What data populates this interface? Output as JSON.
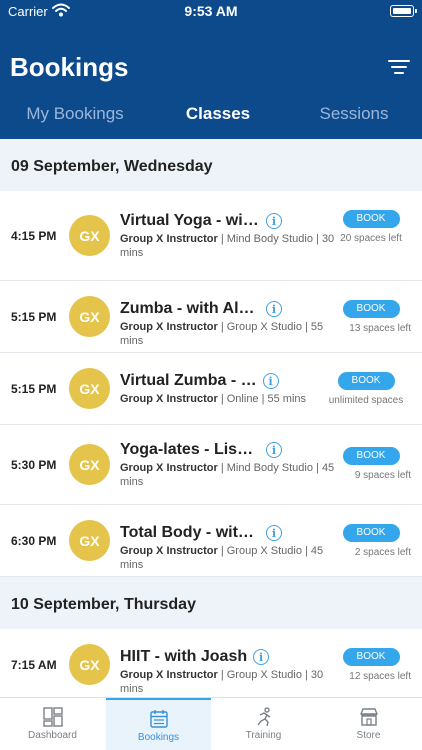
{
  "status_bar": {
    "carrier": "Carrier",
    "time": "9:53 AM"
  },
  "header": {
    "title": "Bookings"
  },
  "tabs": [
    {
      "label": "My Bookings"
    },
    {
      "label": "Classes"
    },
    {
      "label": "Sessions"
    }
  ],
  "sections": [
    {
      "date": "09 September, Wednesday",
      "rows": [
        {
          "time": "4:15 PM",
          "avatar": "GX",
          "name": "Virtual Yoga - wit…",
          "instructor": "Group X Instructor",
          "details": " | Mind Body Studio | 30 mins",
          "book": "BOOK",
          "spaces": "20 spaces left"
        },
        {
          "time": "5:15 PM",
          "avatar": "GX",
          "name": "Zumba - with Alo…",
          "instructor": "Group X Instructor",
          "details": " | Group X Studio | 55 mins",
          "book": "BOOK",
          "spaces": "13 spaces left"
        },
        {
          "time": "5:15 PM",
          "avatar": "GX",
          "name": "Virtual Zumba - …",
          "instructor": "Group X Instructor",
          "details": " | Online | 55 mins",
          "book": "BOOK",
          "spaces": "unlimited spaces"
        },
        {
          "time": "5:30 PM",
          "avatar": "GX",
          "name": "Yoga-lates - Lisa…",
          "instructor": "Group X Instructor",
          "details": " | Mind Body Studio | 45 mins",
          "book": "BOOK",
          "spaces": "9 spaces left"
        },
        {
          "time": "6:30 PM",
          "avatar": "GX",
          "name": "Total Body - with …",
          "instructor": "Group X Instructor",
          "details": " | Group X Studio | 45 mins",
          "book": "BOOK",
          "spaces": "2 spaces left"
        }
      ]
    },
    {
      "date": "10 September, Thursday",
      "rows": [
        {
          "time": "7:15 AM",
          "avatar": "GX",
          "name": "HIIT - with Joash",
          "instructor": "Group X Instructor",
          "details": " | Group X Studio | 30 mins",
          "book": "BOOK",
          "spaces": "12 spaces left"
        }
      ]
    }
  ],
  "info_glyph": "i",
  "bottom_nav": [
    {
      "label": "Dashboard",
      "icon": "dashboard-icon"
    },
    {
      "label": "Bookings",
      "icon": "calendar-icon"
    },
    {
      "label": "Training",
      "icon": "runner-icon"
    },
    {
      "label": "Store",
      "icon": "store-icon"
    }
  ],
  "colors": {
    "header": "#0d4a8c",
    "accent": "#33a6ec",
    "avatar": "#e5c44b"
  }
}
